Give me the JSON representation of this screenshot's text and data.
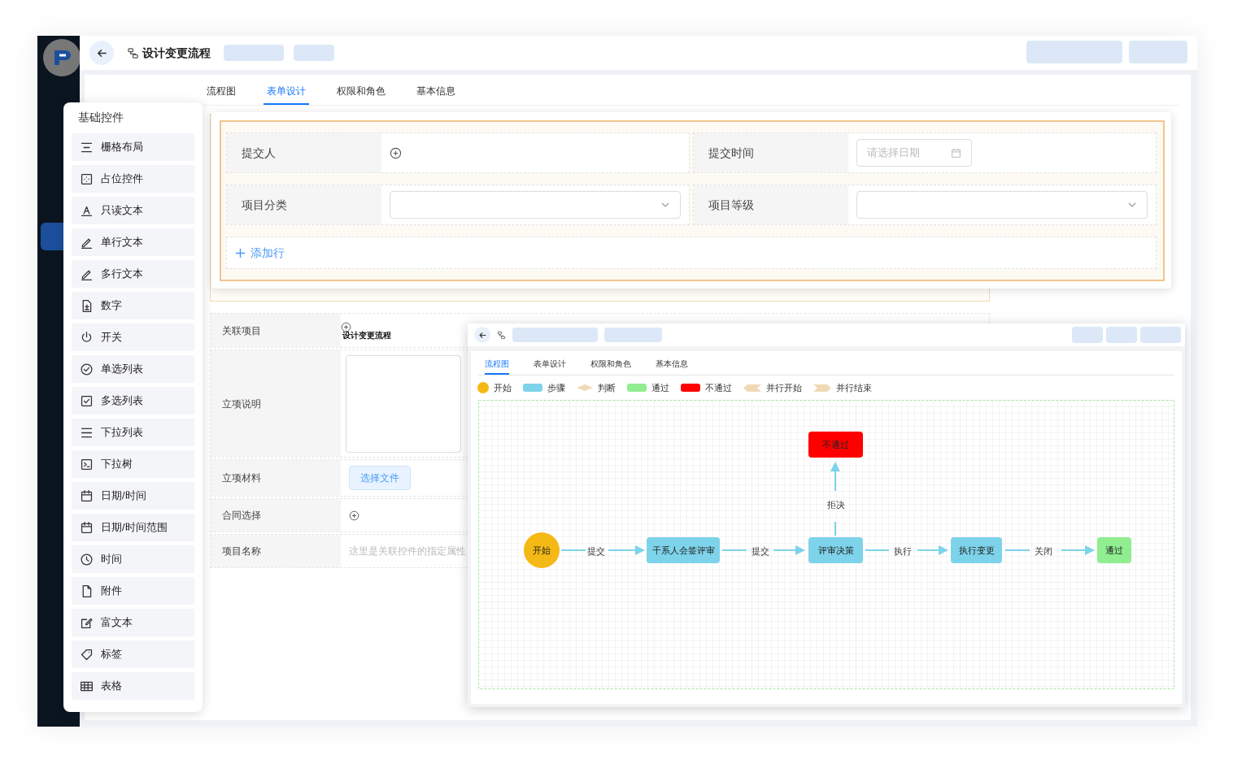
{
  "header": {
    "title": "设计变更流程"
  },
  "tabs": [
    {
      "label": "流程图",
      "selected": false
    },
    {
      "label": "表单设计",
      "selected": true
    },
    {
      "label": "权限和角色",
      "selected": false
    },
    {
      "label": "基本信息",
      "selected": false
    }
  ],
  "palette": {
    "title": "基础控件",
    "items": [
      {
        "label": "栅格布局"
      },
      {
        "label": "占位控件"
      },
      {
        "label": "只读文本"
      },
      {
        "label": "单行文本"
      },
      {
        "label": "多行文本"
      },
      {
        "label": "数字"
      },
      {
        "label": "开关"
      },
      {
        "label": "单选列表"
      },
      {
        "label": "多选列表"
      },
      {
        "label": "下拉列表"
      },
      {
        "label": "下拉树"
      },
      {
        "label": "日期/时间"
      },
      {
        "label": "日期/时间范围"
      },
      {
        "label": "时间"
      },
      {
        "label": "附件"
      },
      {
        "label": "富文本"
      },
      {
        "label": "标签"
      },
      {
        "label": "表格"
      }
    ]
  },
  "form_card": {
    "fields": [
      {
        "label": "提交人",
        "kind": "user"
      },
      {
        "label": "提交时间",
        "kind": "date",
        "placeholder": "请选择日期"
      },
      {
        "label": "项目分类",
        "kind": "select"
      },
      {
        "label": "项目等级",
        "kind": "select"
      }
    ],
    "add_row": "添加行"
  },
  "form_rows": [
    {
      "label": "关联项目",
      "kind": "link",
      "value": "设计变更流程"
    },
    {
      "label": "立项说明",
      "kind": "textarea"
    },
    {
      "label": "立项材料",
      "kind": "file",
      "button": "选择文件"
    },
    {
      "label": "合同选择",
      "kind": "add"
    },
    {
      "label": "项目名称",
      "kind": "text",
      "placeholder": "这里是关联控件的指定属性"
    }
  ],
  "flow_window": {
    "tabs": [
      {
        "label": "流程图",
        "selected": true
      },
      {
        "label": "表单设计",
        "selected": false
      },
      {
        "label": "权限和角色",
        "selected": false
      },
      {
        "label": "基本信息",
        "selected": false
      }
    ],
    "legend": [
      {
        "label": "开始",
        "kind": "circle",
        "color": "#f5b915"
      },
      {
        "label": "步骤",
        "kind": "pill",
        "color": "#7dd3ea"
      },
      {
        "label": "判断",
        "kind": "diamond",
        "color": "#f0d9b5"
      },
      {
        "label": "通过",
        "kind": "pill",
        "color": "#90ee90"
      },
      {
        "label": "不通过",
        "kind": "pill",
        "color": "#ff0000"
      },
      {
        "label": "并行开始",
        "kind": "chevron",
        "color": "#f0d9b5"
      },
      {
        "label": "并行结束",
        "kind": "chevron",
        "color": "#f0d9b5"
      }
    ],
    "nodes": [
      {
        "label": "不通过",
        "kind": "end",
        "color": "#ff0000"
      },
      {
        "label": "开始",
        "kind": "start",
        "color": "#f5b915"
      },
      {
        "label": "干系人会签评审",
        "kind": "step",
        "color": "#7dd3ea"
      },
      {
        "label": "评审决策",
        "kind": "step",
        "color": "#7dd3ea"
      },
      {
        "label": "执行变更",
        "kind": "step",
        "color": "#7dd3ea"
      },
      {
        "label": "通过",
        "kind": "end",
        "color": "#90ee90"
      }
    ],
    "edges": [
      {
        "label": "提交"
      },
      {
        "label": "提交"
      },
      {
        "label": "执行"
      },
      {
        "label": "关闭"
      },
      {
        "label": "拒决"
      }
    ]
  }
}
